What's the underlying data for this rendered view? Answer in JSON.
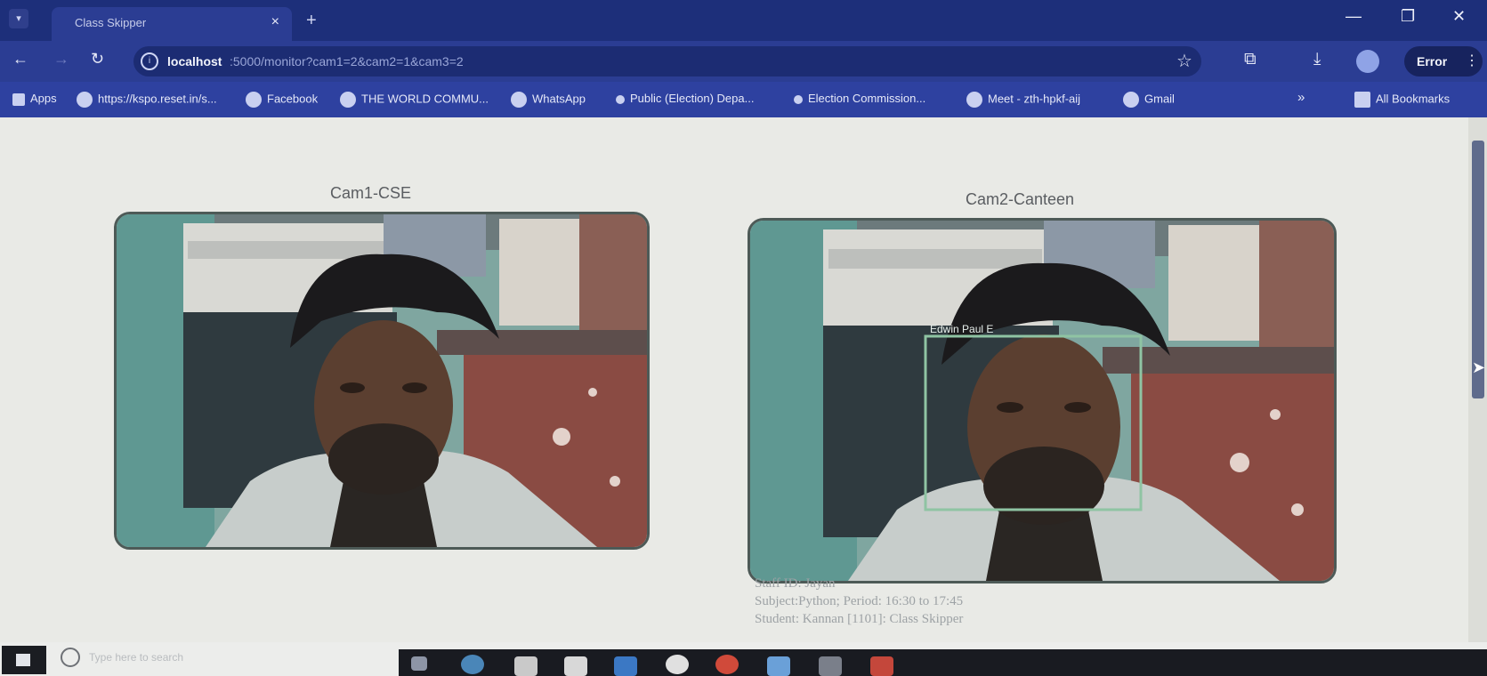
{
  "browser": {
    "tab_title": "Class Skipper",
    "tab_close": "×",
    "new_tab": "+",
    "url_host": "localhost",
    "url_rest": ":5000/monitor?cam1=2&cam2=1&cam3=2",
    "profile_label": "Error",
    "window_controls": [
      "—",
      "❐",
      "✕"
    ],
    "bookmarks": [
      "Apps",
      "https://kspo.reset.in/s...",
      "Facebook",
      "THE WORLD COMMU...",
      "WhatsApp",
      "Public (Election) Depa...",
      "Election Commission...",
      "Meet - zth-hpkf-aij",
      "Gmail",
      "»",
      "All Bookmarks"
    ]
  },
  "cameras": [
    {
      "title": "Cam1-CSE"
    },
    {
      "title": "Cam2-Canteen",
      "detection_label": "Edwin Paul E"
    }
  ],
  "info_lines": [
    "Staff ID: Jayan",
    "Subject:Python; Period: 16:30 to 17:45",
    "Student: Kannan [1101]: Class Skipper"
  ],
  "taskbar": {
    "search_placeholder": "Type here to search"
  },
  "colors": {
    "tab_bar": "#1d2f7a",
    "toolbar": "#2b3d93",
    "bookmarks_bar": "#2e41a0",
    "detection_box": "#8fc4a3"
  }
}
